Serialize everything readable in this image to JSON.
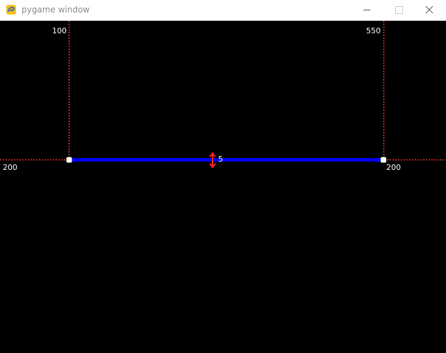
{
  "window": {
    "title": "pygame window",
    "icon": "pygame-snake-icon",
    "controls": [
      "minimize",
      "maximize",
      "close"
    ]
  },
  "canvas": {
    "background": "#000000",
    "guide_color": "#ff3333",
    "line_color": "#0000ff",
    "handle_color": "#ffffff",
    "marker_color": "#ff2a2a",
    "labels": {
      "left_x": "100",
      "right_x": "550",
      "left_y": "200",
      "right_y": "200",
      "width": "5"
    }
  }
}
